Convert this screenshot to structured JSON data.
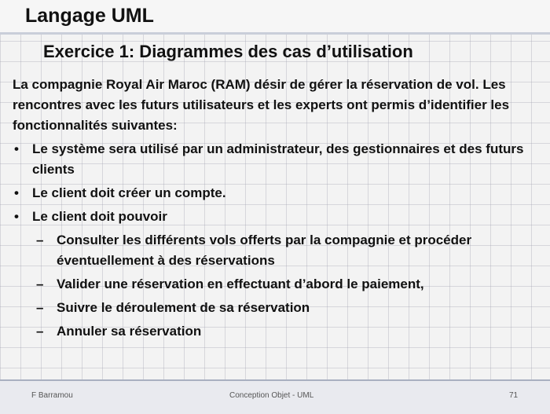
{
  "slide": {
    "title": "Langage UML",
    "subtitle": "Exercice 1: Diagrammes des cas d’utilisation",
    "intro": "La compagnie Royal Air Maroc (RAM) désir de gérer  la réservation de vol.  Les rencontres avec les futurs utilisateurs et les experts ont permis d’identifier les fonctionnalités suivantes:",
    "bullet_marker": "•",
    "dash_marker": "–",
    "bullets": [
      "Le système sera utilisé par un administrateur, des gestionnaires et des futurs clients",
      "Le client doit créer un compte.",
      "Le client doit pouvoir"
    ],
    "sub_bullets": [
      "Consulter les différents vols offerts par la compagnie et procéder éventuellement à des réservations",
      "Valider une réservation en effectuant d’abord le paiement,",
      "Suivre le déroulement de sa réservation",
      "Annuler sa réservation"
    ]
  },
  "footer": {
    "author": "F Barramou",
    "course": "Conception Objet - UML",
    "page": "71"
  }
}
